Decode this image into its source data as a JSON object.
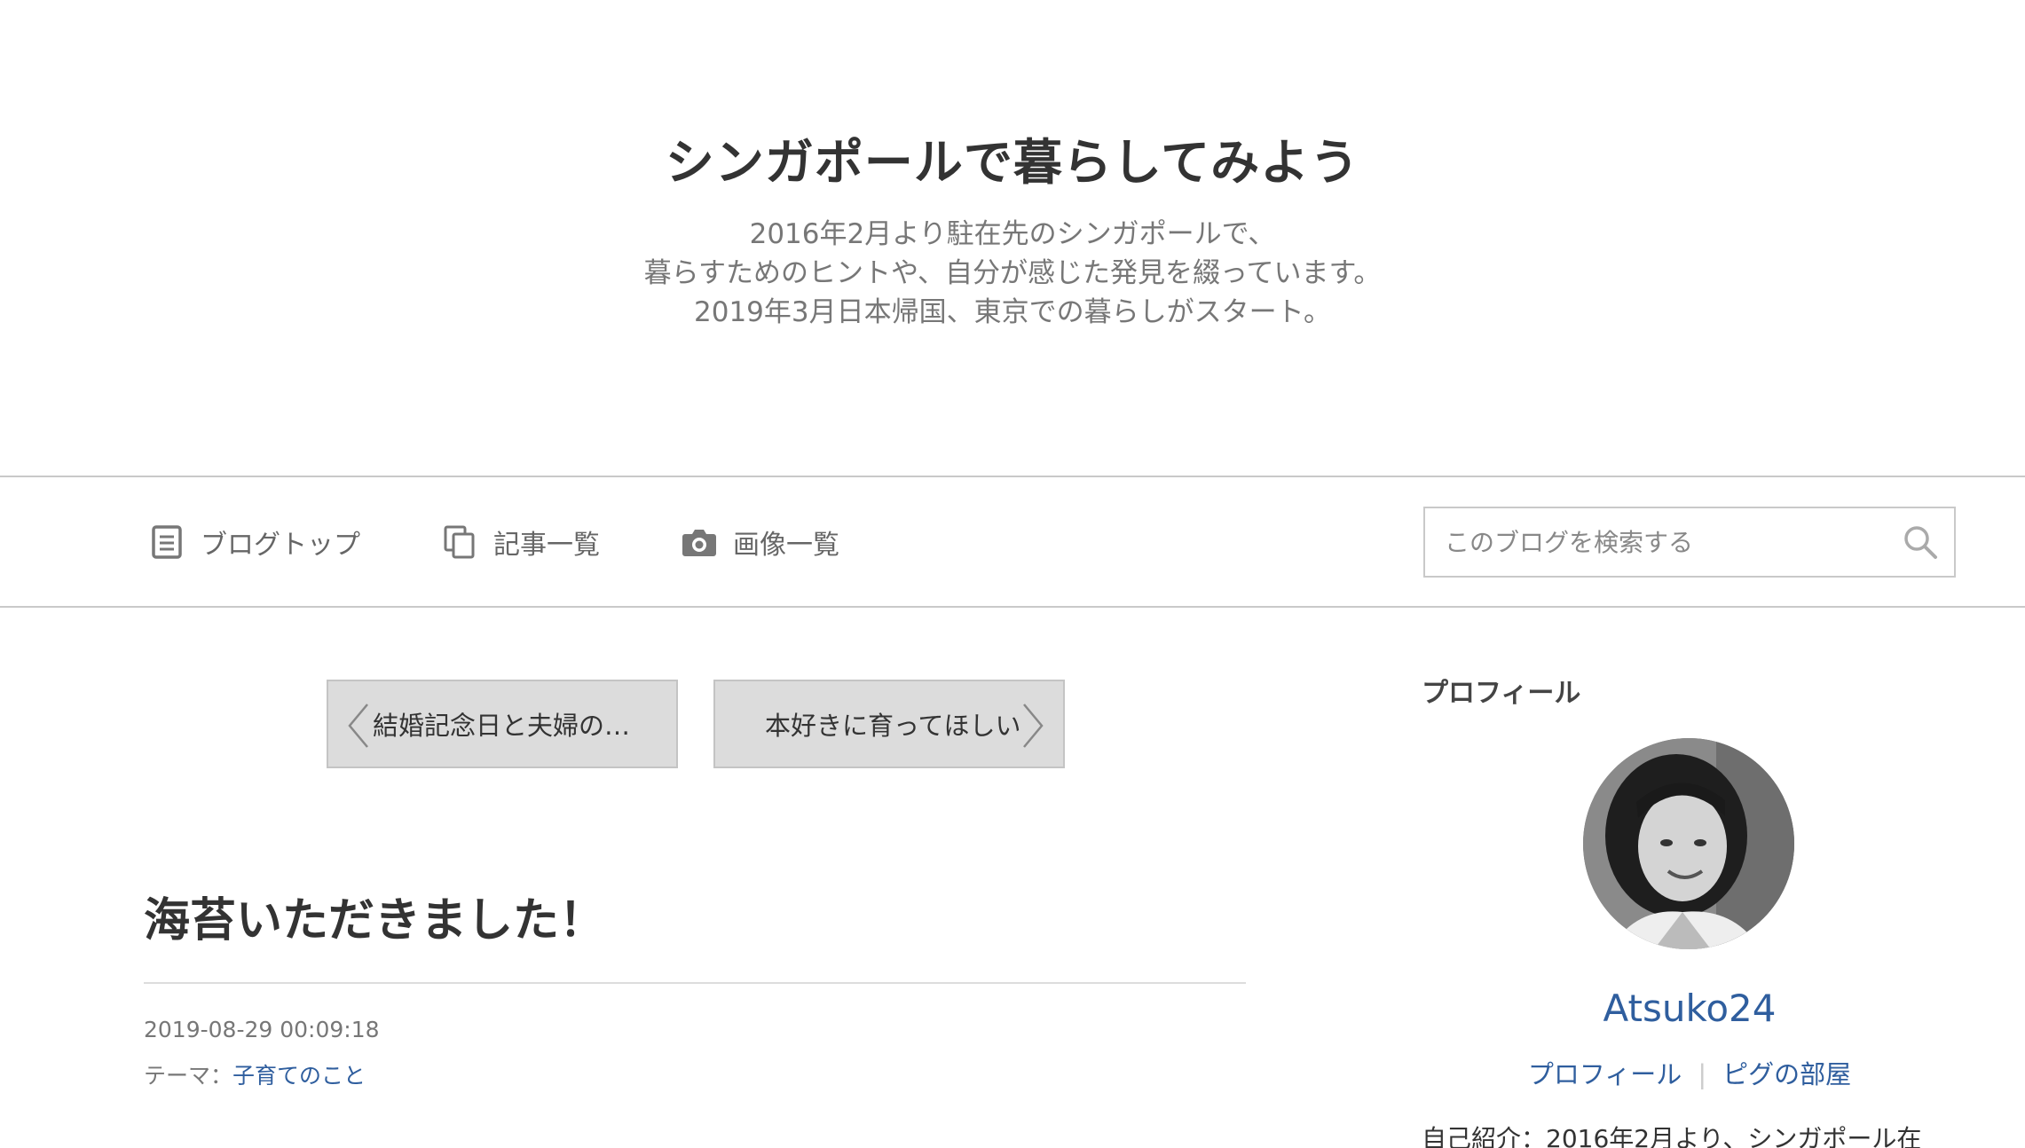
{
  "header": {
    "title": "シンガポールで暮らしてみよう",
    "description": [
      "2016年2月より駐在先のシンガポールで、",
      "暮らすためのヒントや、自分が感じた発見を綴っています。",
      "2019年3月日本帰国、東京での暮らしがスタート。"
    ]
  },
  "nav": {
    "items": [
      {
        "label": "ブログトップ",
        "icon": "document-icon"
      },
      {
        "label": "記事一覧",
        "icon": "copy-icon"
      },
      {
        "label": "画像一覧",
        "icon": "camera-icon"
      }
    ],
    "search": {
      "placeholder": "このブログを検索する",
      "value": ""
    }
  },
  "pager": {
    "prev_label": "結婚記念日と夫婦の…",
    "next_label": "本好きに育ってほしい"
  },
  "article": {
    "title": "海苔いただきました！",
    "date": "2019-08-29 00:09:18",
    "theme_prefix": "テーマ：",
    "theme_link": "子育てのこと"
  },
  "sidebar": {
    "heading": "プロフィール",
    "name": "Atsuko24",
    "links": [
      "プロフィール",
      "ピグの部屋"
    ],
    "separator": "|",
    "intro": "自己紹介：2016年2月より、シンガポール在"
  },
  "colors": {
    "link": "#2f5e9e",
    "border": "#c9c9c9",
    "pager_bg": "#dcdcdc"
  }
}
